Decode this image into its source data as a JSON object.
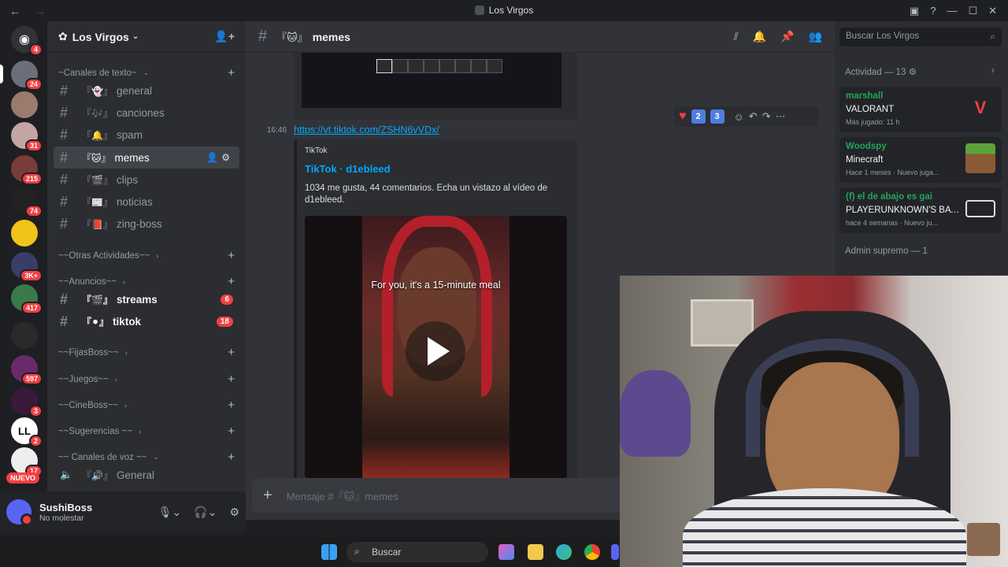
{
  "window": {
    "title": "Los Virgos"
  },
  "guilds": [
    {
      "badge": "4"
    },
    {
      "badge": "24"
    },
    {
      "badge": ""
    },
    {
      "badge": "31"
    },
    {
      "badge": "215"
    },
    {
      "badge": "74"
    },
    {
      "badge": ""
    },
    {
      "badge": "3K+"
    },
    {
      "badge": "417"
    },
    {
      "badge": ""
    },
    {
      "badge": "597"
    },
    {
      "badge": "3"
    },
    {
      "badge": "2"
    },
    {
      "badge": "17"
    }
  ],
  "guilds_new_label": "NUEVO",
  "server": {
    "name": "Los Virgos"
  },
  "sidebar": {
    "categories": [
      {
        "label": "~Canales de texto~"
      },
      {
        "label": "~~Otras Actividades~~"
      },
      {
        "label": "~~Anuncios~~"
      },
      {
        "label": "~~FijasBoss~~"
      },
      {
        "label": "~~Juegos~~"
      },
      {
        "label": "~~CineBoss~~"
      },
      {
        "label": "~~Sugerencias ~~"
      },
      {
        "label": "~~ Canales de voz ~~"
      }
    ],
    "channels": [
      {
        "label": "general"
      },
      {
        "label": "canciones"
      },
      {
        "label": "spam"
      },
      {
        "label": "memes"
      },
      {
        "label": "clips"
      },
      {
        "label": "noticias"
      },
      {
        "label": "zing-boss"
      },
      {
        "label": "streams",
        "count": "6"
      },
      {
        "label": "tiktok",
        "count": "18"
      },
      {
        "label": "General"
      }
    ]
  },
  "user": {
    "name": "SushiBoss",
    "status": "No molestar"
  },
  "channel_header": {
    "name": "memes",
    "bracket": "『🐱』"
  },
  "message": {
    "time": "16:46",
    "link": "https://vt.tiktok.com/ZSHN6vVDx/",
    "reactions": [
      "2",
      "3"
    ],
    "embed": {
      "provider": "TikTok",
      "title": "TikTok · d1ebleed",
      "description": "1034 me gusta, 44 comentarios. Echa un vistazo al vídeo de d1ebleed.",
      "video_caption": "For you, it's a 15-minute meal"
    }
  },
  "composer": {
    "placeholder": "Mensaje #『🐱』memes"
  },
  "members": {
    "search_placeholder": "Buscar Los Virgos",
    "activity_header": "Actividad — 13",
    "activities": [
      {
        "user": "marshall",
        "game": "VALORANT",
        "meta": "Más jugado: 11 h"
      },
      {
        "user": "Woodspy",
        "game": "Minecraft",
        "meta": "Hace 1 meses · Nuevo juga..."
      },
      {
        "user": "(f) el de abajo es gai",
        "game": "PLAYERUNKNOWN'S BATT...",
        "meta": "hace 4 semanas · Nuevo ju..."
      }
    ],
    "role_header": "Admin supremo — 1",
    "role_member": "SushiBoss"
  },
  "taskbar": {
    "search_label": "Buscar"
  },
  "colors": {
    "accent": "#5865f2",
    "danger": "#f23f43",
    "link": "#00a8fc",
    "online": "#23a55a"
  }
}
